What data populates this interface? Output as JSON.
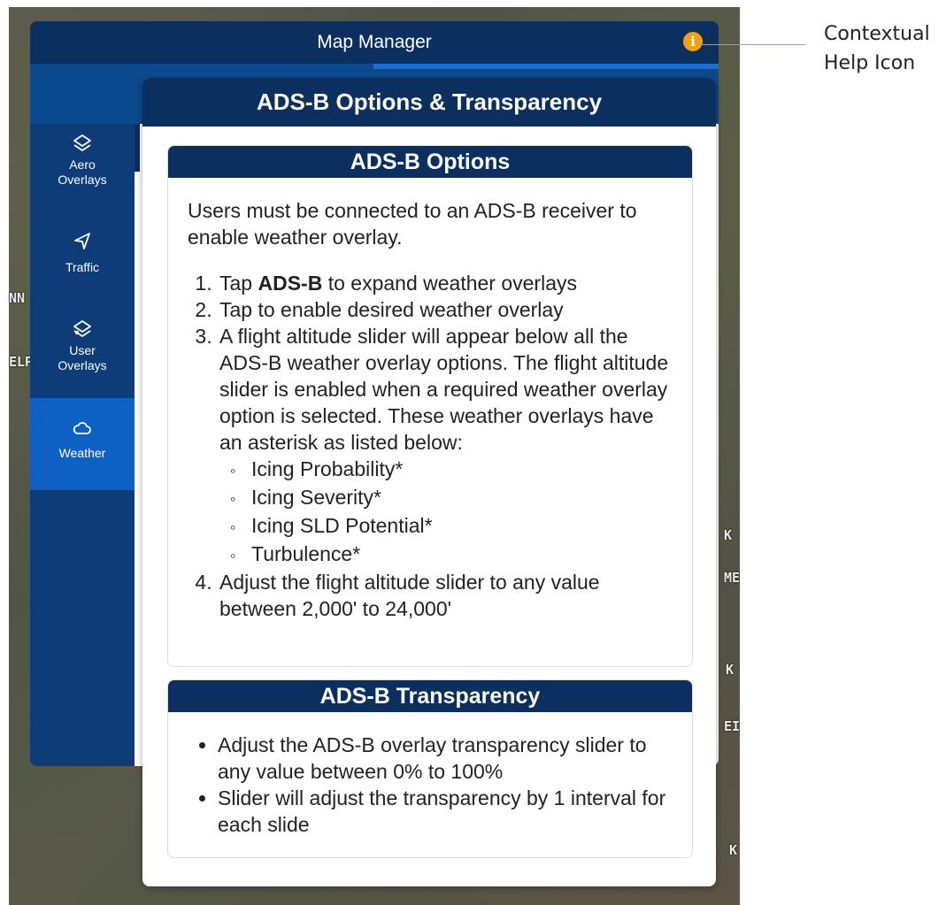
{
  "map_manager": {
    "title": "Map Manager",
    "help_icon_glyph": "i",
    "sidebar": [
      {
        "label_line1": "Aero",
        "label_line2": "Overlays",
        "icon": "layers-icon"
      },
      {
        "label_line1": "Traffic",
        "label_line2": "",
        "icon": "navigation-arrow-icon"
      },
      {
        "label_line1": "User",
        "label_line2": "Overlays",
        "icon": "user-layers-icon"
      },
      {
        "label_line1": "Weather",
        "label_line2": "",
        "icon": "cloud-icon",
        "active": true
      }
    ]
  },
  "help_dialog": {
    "title": "ADS-B Options & Transparency",
    "options_card": {
      "heading": "ADS-B Options",
      "intro": "Users must be connected to an ADS-B receiver to enable weather overlay.",
      "step1_prefix": "Tap ",
      "step1_bold": "ADS-B",
      "step1_suffix": " to expand weather overlays",
      "step2": "Tap to enable desired weather overlay",
      "step3": "A flight altitude slider will appear below all the ADS-B weather overlay options. The flight altitude slider is enabled when a required weather overlay option is selected. These weather overlays have an asterisk as listed below:",
      "sub_items": [
        "Icing Probability*",
        "Icing Severity*",
        "Icing SLD Potential*",
        "Turbulence*"
      ],
      "step4": "Adjust the flight altitude slider to any value between 2,000' to 24,000'"
    },
    "transparency_card": {
      "heading": "ADS-B Transparency",
      "bullets": [
        "Adjust the ADS-B overlay transparency slider to any value between 0% to 100%",
        "Slider will adjust the transparency by 1 interval for each slide"
      ]
    }
  },
  "callout": {
    "line1": "Contextual",
    "line2": "Help Icon"
  },
  "colors": {
    "header_navy": "#0b2f5e",
    "panel_blue": "#0c3f7f",
    "active_blue": "#0d61c4",
    "help_orange": "#f2a20f"
  }
}
